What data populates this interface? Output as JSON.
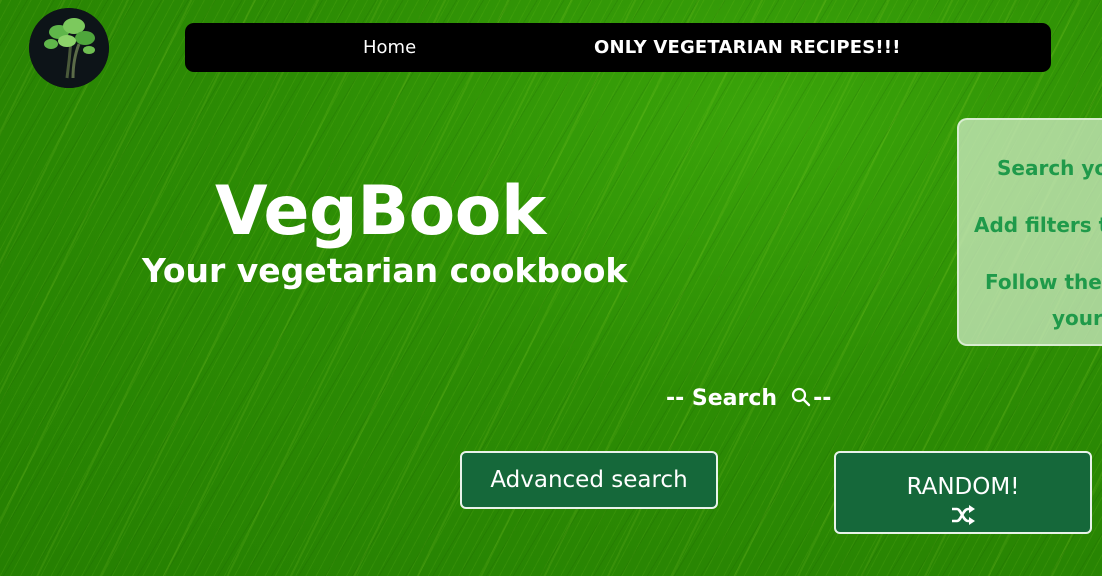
{
  "header": {
    "logo_icon": "parsley-icon",
    "nav": {
      "home_label": "Home",
      "slogan": "ONLY VEGETARIAN RECIPES!!!"
    }
  },
  "hero": {
    "title": "VegBook",
    "subtitle": "Your vegetarian cookbook"
  },
  "info_panel": {
    "lines": [
      "Search you",
      "Add filters to",
      "Follow the",
      "your"
    ]
  },
  "search": {
    "prefix": "-- Search",
    "suffix": "--",
    "icon": "search-icon"
  },
  "buttons": {
    "advanced_label": "Advanced search",
    "random_label": "RANDOM!",
    "random_icon": "shuffle-icon"
  },
  "colors": {
    "background": "#2f8f06",
    "navbar": "#000000",
    "button": "#15683a",
    "panel_text": "#1f9a4a"
  }
}
